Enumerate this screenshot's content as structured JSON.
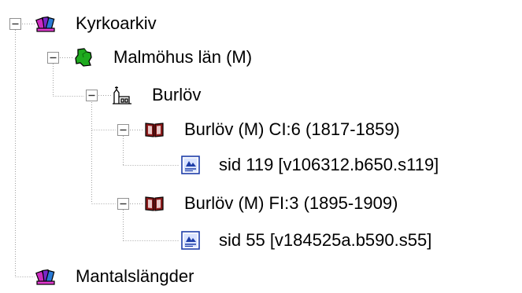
{
  "tree": {
    "nodes": [
      {
        "id": "kyrkoarkiv",
        "label": "Kyrkoarkiv",
        "icon": "archive-books-icon",
        "expanded": true,
        "has_expander": true
      },
      {
        "id": "malmohus",
        "label": "Malmöhus län (M)",
        "icon": "county-map-icon",
        "expanded": true,
        "has_expander": true
      },
      {
        "id": "burlov",
        "label": "Burlöv",
        "icon": "parish-church-icon",
        "expanded": true,
        "has_expander": true
      },
      {
        "id": "burlov-ci6",
        "label": "Burlöv (M) CI:6 (1817-1859)",
        "icon": "open-book-icon",
        "expanded": true,
        "has_expander": true
      },
      {
        "id": "sid119",
        "label": "sid  119 [v106312.b650.s119]",
        "icon": "page-image-icon",
        "has_expander": false
      },
      {
        "id": "burlov-fi3",
        "label": "Burlöv (M) FI:3 (1895-1909)",
        "icon": "open-book-icon",
        "expanded": true,
        "has_expander": true
      },
      {
        "id": "sid55",
        "label": "sid  55 [v184525a.b590.s55]",
        "icon": "page-image-icon",
        "has_expander": false
      },
      {
        "id": "mantalslangder",
        "label": "Mantalslängder",
        "icon": "archive-books-icon",
        "has_expander": false
      }
    ]
  },
  "colors": {
    "connector": "#a0a0a0",
    "expander_border": "#919191",
    "book_red": "#8b1a1a",
    "map_green": "#1faa1f",
    "page_blue": "#1e3ea8"
  }
}
